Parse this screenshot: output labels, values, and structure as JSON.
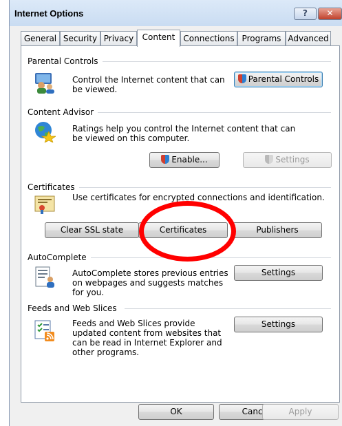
{
  "window": {
    "title": "Internet Options",
    "help_label": "?",
    "close_label": "✕"
  },
  "tabs": [
    {
      "label": "General"
    },
    {
      "label": "Security"
    },
    {
      "label": "Privacy"
    },
    {
      "label": "Content",
      "active": true
    },
    {
      "label": "Connections"
    },
    {
      "label": "Programs"
    },
    {
      "label": "Advanced"
    }
  ],
  "parental_controls": {
    "heading": "Parental Controls",
    "description": "Control the Internet content that can be viewed.",
    "button_label": "Parental Controls"
  },
  "content_advisor": {
    "heading": "Content Advisor",
    "description": "Ratings help you control the Internet content that can be viewed on this computer.",
    "enable_label": "Enable...",
    "settings_label": "Settings"
  },
  "certificates": {
    "heading": "Certificates",
    "description": "Use certificates for encrypted connections and identification.",
    "clear_ssl_label": "Clear SSL state",
    "certificates_label": "Certificates",
    "publishers_label": "Publishers"
  },
  "autocomplete": {
    "heading": "AutoComplete",
    "description": "AutoComplete stores previous entries on webpages and suggests matches for you.",
    "settings_label": "Settings"
  },
  "feeds": {
    "heading": "Feeds and Web Slices",
    "description": "Feeds and Web Slices provide updated content from websites that can be read in Internet Explorer and other programs.",
    "settings_label": "Settings"
  },
  "footer": {
    "ok_label": "OK",
    "cancel_label": "Cancel",
    "apply_label": "Apply"
  },
  "colors": {
    "annotation": "#ff0000",
    "focus_border": "#3c7fb1"
  }
}
